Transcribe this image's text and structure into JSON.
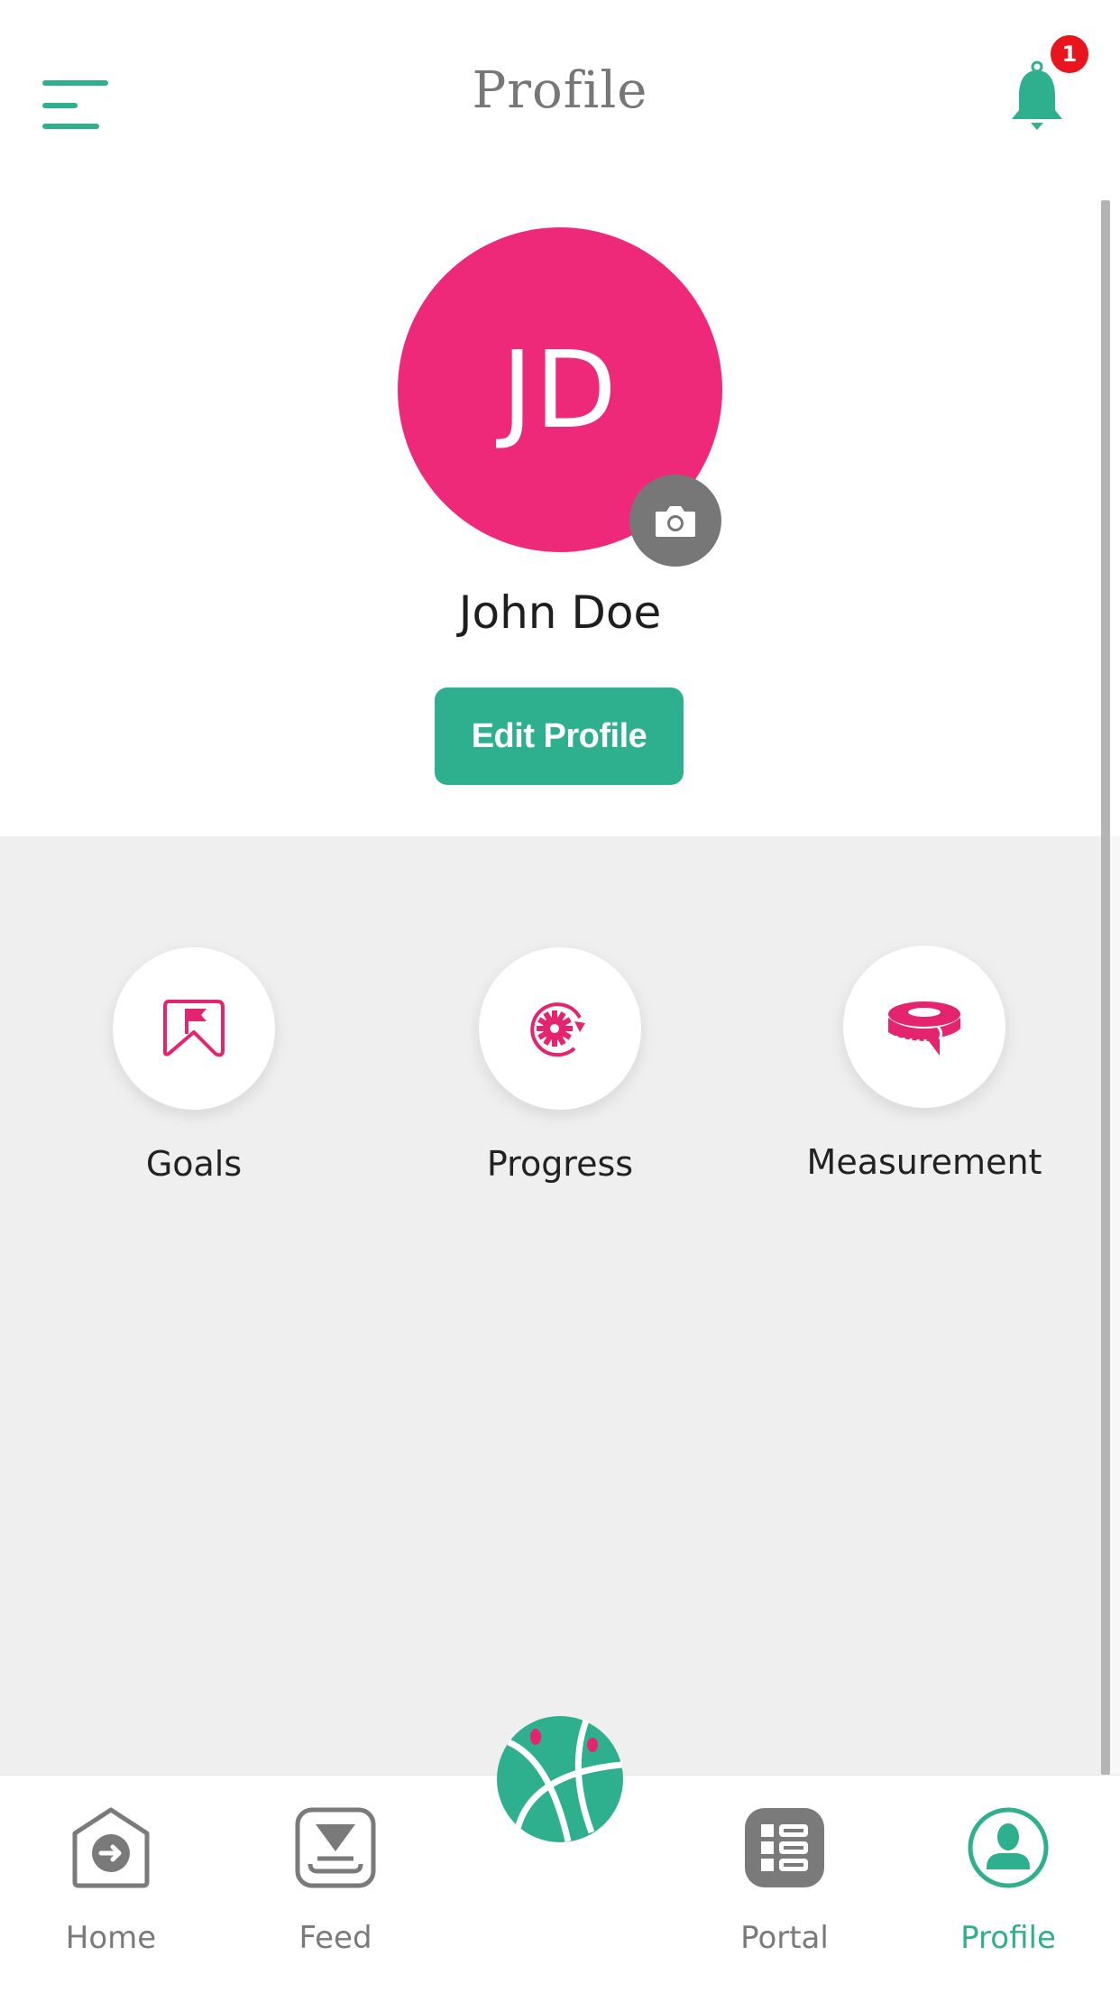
{
  "header": {
    "title": "Profile",
    "menu_icon": "menu-icon",
    "notification_icon": "bell-icon",
    "notification_count": "1"
  },
  "profile": {
    "initials": "JD",
    "name": "John Doe",
    "edit_button_label": "Edit Profile",
    "camera_icon": "camera-icon"
  },
  "tiles": [
    {
      "label": "Goals",
      "icon": "goal-flag-icon"
    },
    {
      "label": "Progress",
      "icon": "progress-gear-icon"
    },
    {
      "label": "Measurement",
      "icon": "measuring-tape-icon"
    }
  ],
  "bottom_nav": {
    "items": [
      {
        "label": "Home",
        "icon": "home-icon",
        "active": false
      },
      {
        "label": "Feed",
        "icon": "feed-icon",
        "active": false
      },
      {
        "label": "",
        "icon": "basketball-icon",
        "active": false
      },
      {
        "label": "Portal",
        "icon": "portal-icon",
        "active": false
      },
      {
        "label": "Profile",
        "icon": "profile-icon",
        "active": true
      }
    ]
  },
  "colors": {
    "accent": "#2eb08e",
    "avatar": "#ee297a",
    "icon_pink": "#e5246f",
    "badge": "#e8141e",
    "gray_bg": "#efefef",
    "inactive": "#7a7a7a"
  }
}
